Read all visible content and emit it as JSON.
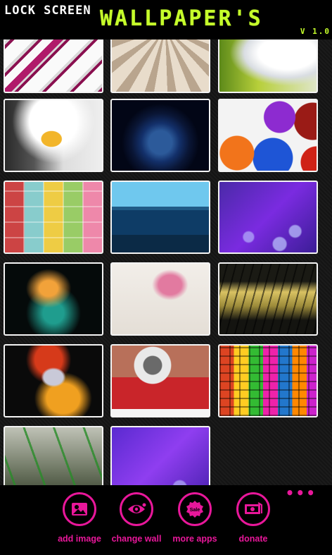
{
  "header": {
    "title_small": "LOCK SCREEN",
    "title_big": "WALLPAPER'S",
    "version": "V 1.0"
  },
  "colors": {
    "accent": "#e8179a",
    "title_green": "#c6ff2b",
    "background": "#000000"
  },
  "wallpapers": [
    {
      "name": "cubes-pattern"
    },
    {
      "name": "umbrella-ribs"
    },
    {
      "name": "white-bird"
    },
    {
      "name": "bald-eagle"
    },
    {
      "name": "earth-at-night"
    },
    {
      "name": "colorful-dots"
    },
    {
      "name": "pastel-squares"
    },
    {
      "name": "sea-cliffs"
    },
    {
      "name": "purple-droplets"
    },
    {
      "name": "abstract-smoke"
    },
    {
      "name": "pink-flower"
    },
    {
      "name": "grass-sunset"
    },
    {
      "name": "krishna"
    },
    {
      "name": "eye-closeup"
    },
    {
      "name": "color-weave"
    },
    {
      "name": "bamboo"
    },
    {
      "name": "purple-droplets-2"
    }
  ],
  "appbar": {
    "more": "•••",
    "add_image": {
      "label": "add image",
      "icon": "image-icon"
    },
    "change_wall": {
      "label": "change wall",
      "icon": "eye-icon"
    },
    "more_apps": {
      "label": "more apps",
      "icon": "sale-icon",
      "badge": "Sale"
    },
    "donate": {
      "label": "donate",
      "icon": "money-icon"
    }
  }
}
